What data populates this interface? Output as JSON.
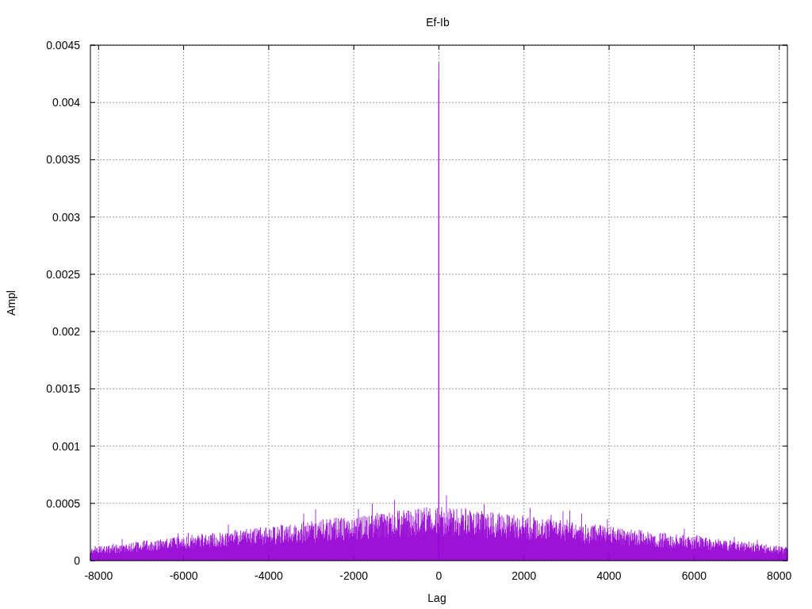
{
  "plot": {
    "title": "Ef-Ib",
    "xlabel": "Lag",
    "ylabel": "Ampl",
    "xticks": [
      "-8000",
      "-6000",
      "-4000",
      "-2000",
      "0",
      "2000",
      "4000",
      "6000",
      "8000"
    ],
    "yticks": [
      "0.0045",
      "0.004",
      "0.0035",
      "0.003",
      "0.0025",
      "0.002",
      "0.0015",
      "0.001",
      "0.0005",
      "0"
    ]
  }
}
